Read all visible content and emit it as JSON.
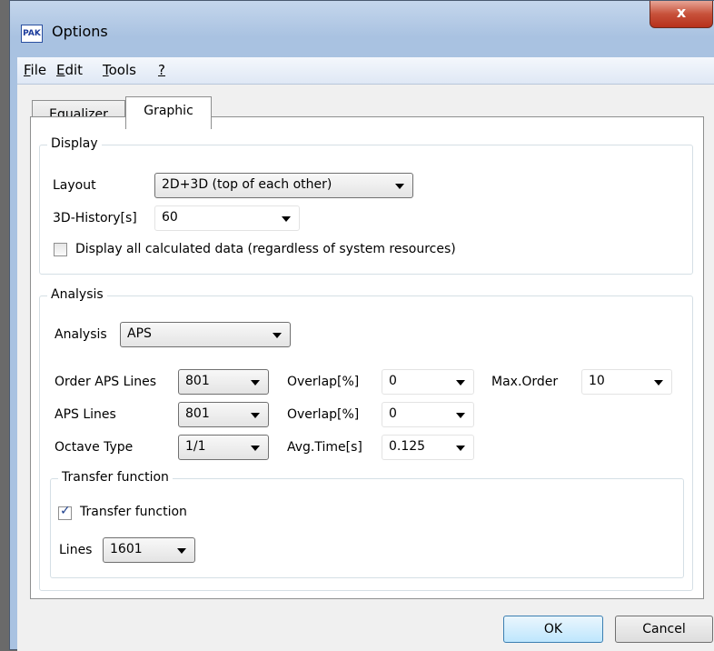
{
  "window": {
    "title": "Options",
    "logo_text": "PAK",
    "close_glyph": "x"
  },
  "menu": [
    {
      "label": "File",
      "accel": "F",
      "rest": "ile"
    },
    {
      "label": "Edit",
      "accel": "E",
      "rest": "dit"
    },
    {
      "label": "Tools",
      "accel": "T",
      "rest": "ools"
    },
    {
      "label": "?",
      "accel": "?",
      "rest": ""
    }
  ],
  "tabs": [
    {
      "label": "Equalizer",
      "active": false
    },
    {
      "label": "Graphic",
      "active": true
    }
  ],
  "display": {
    "title": "Display",
    "layout_label": "Layout",
    "layout_value": "2D+3D (top of each other)",
    "history_label": "3D-History[s]",
    "history_value": "60",
    "display_all_label": "Display all calculated data (regardless of system resources)",
    "display_all_checked": false
  },
  "analysis": {
    "title": "Analysis",
    "analysis_label": "Analysis",
    "analysis_value": "APS",
    "order_aps_lines_label": "Order APS Lines",
    "order_aps_lines_value": "801",
    "overlap1_label": "Overlap[%]",
    "overlap1_value": "0",
    "max_order_label": "Max.Order",
    "max_order_value": "10",
    "aps_lines_label": "APS Lines",
    "aps_lines_value": "801",
    "overlap2_label": "Overlap[%]",
    "overlap2_value": "0",
    "octave_type_label": "Octave Type",
    "octave_type_value": "1/1",
    "avg_time_label": "Avg.Time[s]",
    "avg_time_value": "0.125"
  },
  "transfer": {
    "title": "Transfer function",
    "checkbox_label": "Transfer function",
    "checked": true,
    "lines_label": "Lines",
    "lines_value": "1601"
  },
  "buttons": {
    "ok": "OK",
    "cancel": "Cancel"
  },
  "check_glyph": "✓"
}
